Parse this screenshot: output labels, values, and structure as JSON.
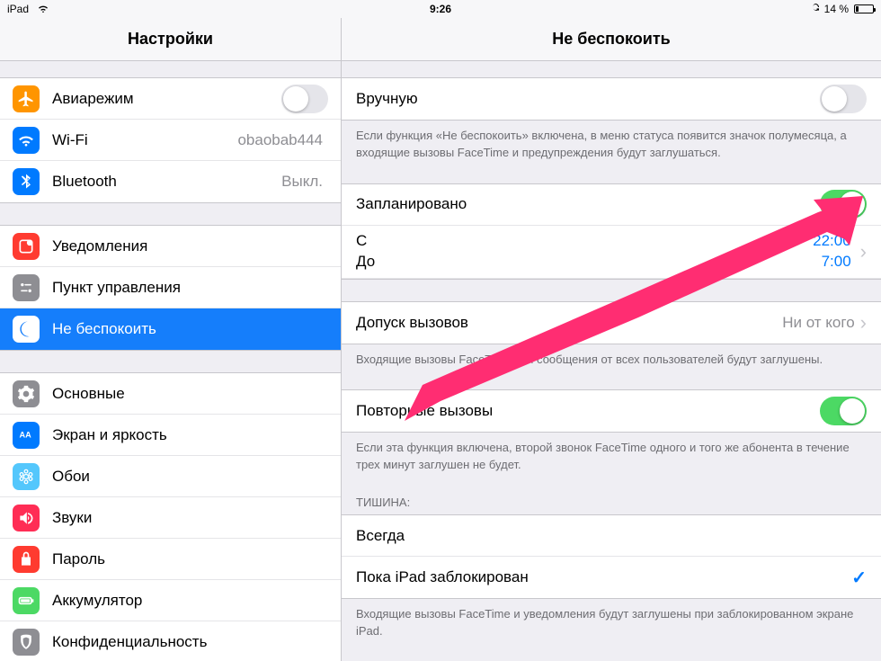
{
  "statusbar": {
    "device": "iPad",
    "wifi": "wifi",
    "time": "9:26",
    "lock": "lock",
    "batteryText": "14 %"
  },
  "sidebar": {
    "title": "Настройки",
    "group1": [
      {
        "id": "airplane",
        "label": "Авиарежим",
        "type": "switch",
        "on": false,
        "iconBg": "#ff9500",
        "icon": "airplane"
      },
      {
        "id": "wifi",
        "label": "Wi-Fi",
        "type": "value",
        "value": "obaobab444",
        "iconBg": "#007aff",
        "icon": "wifi"
      },
      {
        "id": "bluetooth",
        "label": "Bluetooth",
        "type": "value",
        "value": "Выкл.",
        "iconBg": "#007aff",
        "icon": "bluetooth"
      }
    ],
    "group2": [
      {
        "id": "notifications",
        "label": "Уведомления",
        "iconBg": "#ff3b30",
        "icon": "notif"
      },
      {
        "id": "controlcenter",
        "label": "Пункт управления",
        "iconBg": "#8e8e93",
        "icon": "control"
      },
      {
        "id": "dnd",
        "label": "Не беспокоить",
        "iconBg": "#5856d6",
        "icon": "moon",
        "selected": true
      }
    ],
    "group3": [
      {
        "id": "general",
        "label": "Основные",
        "iconBg": "#8e8e93",
        "icon": "gear"
      },
      {
        "id": "display",
        "label": "Экран и яркость",
        "iconBg": "#007aff",
        "icon": "display"
      },
      {
        "id": "wallpaper",
        "label": "Обои",
        "iconBg": "#54c7fc",
        "icon": "wallpaper"
      },
      {
        "id": "sounds",
        "label": "Звуки",
        "iconBg": "#ff2d55",
        "icon": "sounds"
      },
      {
        "id": "passcode",
        "label": "Пароль",
        "iconBg": "#ff3b30",
        "icon": "passcode"
      },
      {
        "id": "battery",
        "label": "Аккумулятор",
        "iconBg": "#4cd964",
        "icon": "batt"
      },
      {
        "id": "privacy",
        "label": "Конфиденциальность",
        "iconBg": "#8e8e93",
        "icon": "privacy"
      }
    ]
  },
  "detail": {
    "title": "Не беспокоить",
    "manual": {
      "label": "Вручную",
      "on": false
    },
    "manualNote": "Если функция «Не беспокоить» включена, в меню статуса появится значок полумесяца, а входящие вызовы FaceTime и предупреждения будут заглушаться.",
    "scheduled": {
      "label": "Запланировано",
      "on": true
    },
    "timeRow": {
      "fromLabel": "С",
      "toLabel": "До",
      "fromValue": "22:00",
      "toValue": "7:00"
    },
    "allowCalls": {
      "label": "Допуск вызовов",
      "value": "Ни от кого"
    },
    "allowCallsNote": "Входящие вызовы FaceTime или сообщения от всех пользователей будут заглушены.",
    "repeated": {
      "label": "Повторные вызовы",
      "on": true
    },
    "repeatedNote": "Если эта функция включена, второй звонок FaceTime одного и того же абонента в течение трех минут заглушен не будет.",
    "silenceHeader": "ТИШИНА:",
    "silenceOpts": [
      {
        "label": "Всегда",
        "checked": false
      },
      {
        "label": "Пока iPad заблокирован",
        "checked": true
      }
    ],
    "silenceNote": "Входящие вызовы FaceTime и уведомления будут заглушены при заблокированном экране iPad."
  }
}
